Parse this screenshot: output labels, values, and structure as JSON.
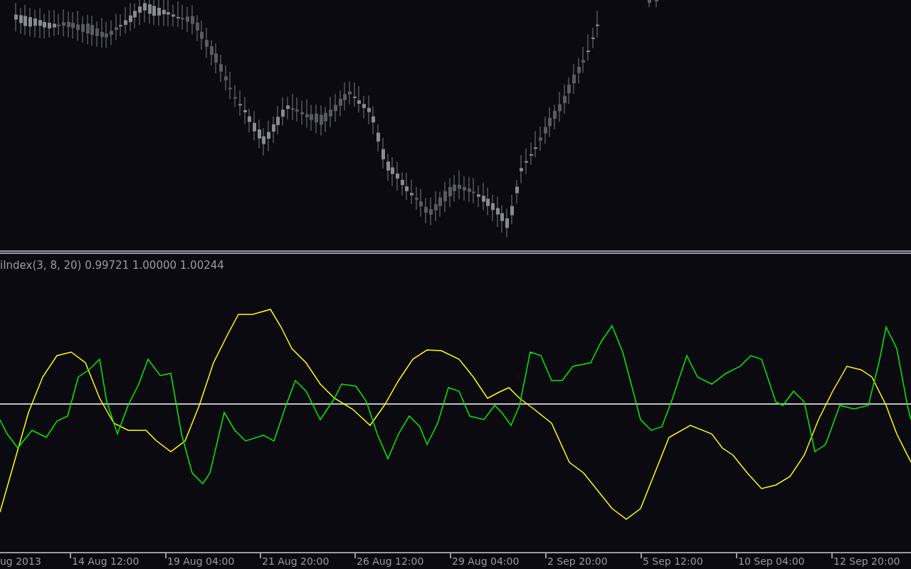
{
  "indicator": {
    "label": "iIndex(3, 8, 20) 0.99721 1.00000 1.00244"
  },
  "time_axis": {
    "labels": [
      "ug 2013",
      "14 Aug 12:00",
      "19 Aug 04:00",
      "21 Aug 20:00",
      "26 Aug 12:00",
      "29 Aug 04:00",
      "2 Sep 20:00",
      "5 Sep 12:00",
      "10 Sep 04:00",
      "12 Sep 20:00"
    ]
  }
}
